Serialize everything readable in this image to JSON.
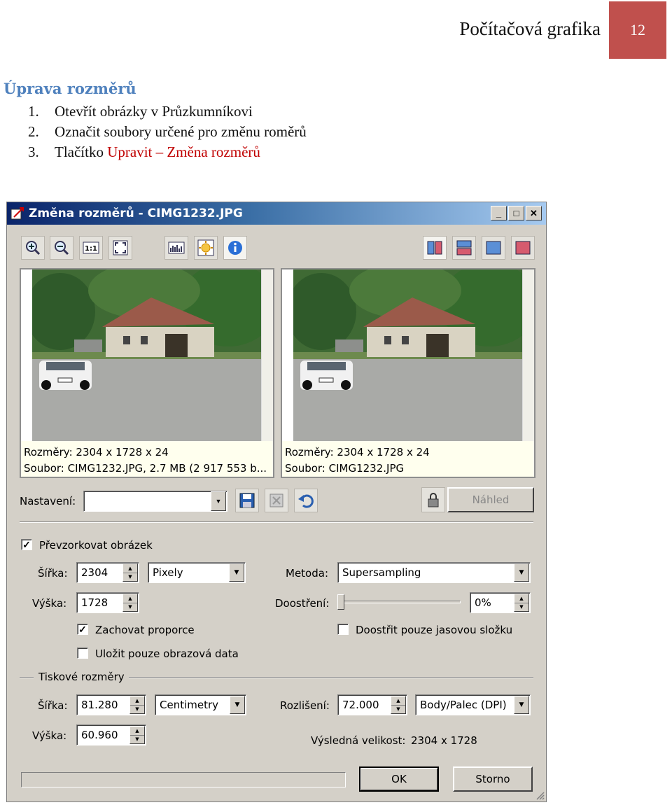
{
  "document": {
    "header_title": "Počítačová grafika",
    "page_number": "12",
    "section_heading": "Úprava rozměrů",
    "steps": [
      {
        "num": "1.",
        "text": "Otevřít obrázky v Průzkumníkovi",
        "highlight": ""
      },
      {
        "num": "2.",
        "text": "Označit soubory určené pro změnu roměrů",
        "highlight": ""
      },
      {
        "num": "3.",
        "text": "Tlačítko ",
        "highlight": "Upravit – Změna rozměrů"
      }
    ]
  },
  "dialog": {
    "title": "Změna rozměrů - CIMG1232.JPG",
    "window_buttons": {
      "minimize": "_",
      "maximize": "□",
      "close": "✕"
    },
    "toolbar_left": [
      "zoom-in-icon",
      "zoom-out-icon",
      "actual-size-icon",
      "fit-window-icon",
      "histogram-icon",
      "color-adjust-icon",
      "info-icon"
    ],
    "toolbar_right": [
      "split-vertical-icon",
      "split-horizontal-icon",
      "view-original-icon",
      "view-result-icon"
    ],
    "original_panel": {
      "line1": "Rozměry: 2304 x 1728 x 24",
      "line2": "Soubor: CIMG1232.JPG, 2.7 MB (2 917 553 b..."
    },
    "preview_panel": {
      "line1": "Rozměry: 2304 x 1728 x 24",
      "line2": "Soubor: CIMG1232.JPG"
    },
    "settings": {
      "nastaveni_label": "Nastavení:",
      "nastaveni_value": "",
      "preview_button": "Náhled"
    },
    "resample": {
      "checkbox_label": "Převzorkovat obrázek",
      "checked": true,
      "width_label": "Šířka:",
      "width_value": "2304",
      "unit_value": "Pixely",
      "height_label": "Výška:",
      "height_value": "1728",
      "method_label": "Metoda:",
      "method_value": "Supersampling",
      "sharpen_label": "Doostření:",
      "sharpen_value": "0%",
      "sharpen_level": 0,
      "keep_ratio_label": "Zachovat proporce",
      "keep_ratio_checked": true,
      "image_only_label": "Uložit pouze obrazová data",
      "image_only_checked": false,
      "luma_only_label": "Doostřit pouze jasovou složku",
      "luma_only_checked": false
    },
    "print": {
      "group_label": "Tiskové rozměry",
      "width_label": "Šířka:",
      "width_value": "81.280",
      "unit_value": "Centimetry",
      "height_label": "Výška:",
      "height_value": "60.960",
      "resolution_label": "Rozlišení:",
      "resolution_value": "72.000",
      "resolution_unit": "Body/Palec (DPI)",
      "result_label": "Výsledná velikost:",
      "result_value": "2304 x 1728"
    },
    "buttons": {
      "ok": "OK",
      "cancel": "Storno"
    }
  }
}
